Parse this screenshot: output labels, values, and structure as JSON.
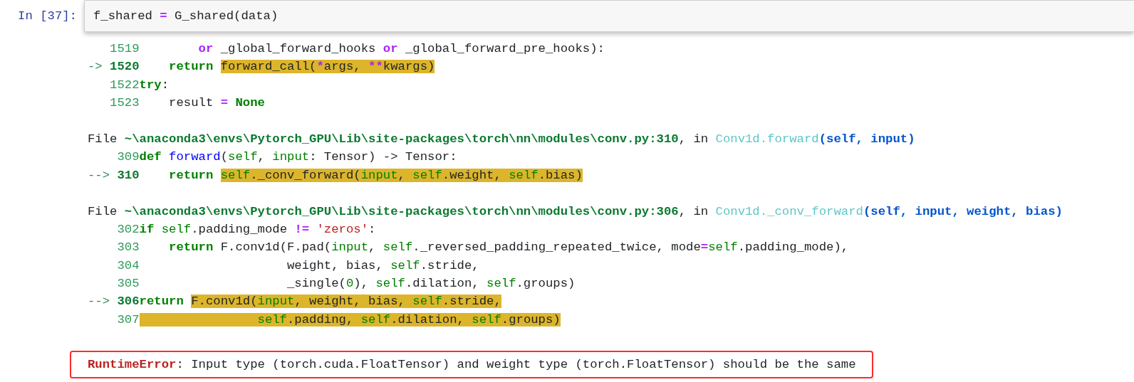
{
  "input_cell": {
    "prompt": "In [37]:",
    "tokens": [
      {
        "text": "f_shared ",
        "kind": "plain"
      },
      {
        "text": "=",
        "kind": "op"
      },
      {
        "text": " G_shared(data)",
        "kind": "plain"
      }
    ]
  },
  "output_lines": [
    {
      "kind": "code",
      "number": "1519",
      "current": false,
      "tokens": [
        {
          "text": "        or",
          "kind": "op"
        },
        {
          "text": " _global_forward_hooks ",
          "kind": "plain"
        },
        {
          "text": "or",
          "kind": "op"
        },
        {
          "text": " _global_forward_pre_hooks):",
          "kind": "plain"
        }
      ]
    },
    {
      "kind": "code",
      "marker": "->",
      "number": "1520",
      "current": true,
      "tokens": [
        {
          "text": "    return ",
          "kind": "kw"
        }
      ],
      "highlight": [
        {
          "text": "forward_call(",
          "kind": "plain"
        },
        {
          "text": "*",
          "kind": "op"
        },
        {
          "text": "args, ",
          "kind": "plain"
        },
        {
          "text": "**",
          "kind": "op"
        },
        {
          "text": "kwargs)",
          "kind": "plain"
        }
      ]
    },
    {
      "kind": "code",
      "number": "1522",
      "current": false,
      "tokens": [
        {
          "text": "try",
          "kind": "kw"
        },
        {
          "text": ":",
          "kind": "plain"
        }
      ]
    },
    {
      "kind": "code",
      "number": "1523",
      "current": false,
      "tokens": [
        {
          "text": "    result ",
          "kind": "plain"
        },
        {
          "text": "=",
          "kind": "op"
        },
        {
          "text": " None",
          "kind": "kw"
        }
      ]
    },
    {
      "kind": "blank"
    },
    {
      "kind": "file",
      "tokens": [
        {
          "text": "File ",
          "kind": "plain"
        },
        {
          "text": "~\\anaconda3\\envs\\Pytorch_GPU\\Lib\\site-packages\\torch\\nn\\modules\\conv.py:310",
          "kind": "path"
        },
        {
          "text": ", in ",
          "kind": "plain"
        },
        {
          "text": "Conv1d.forward",
          "kind": "frame"
        },
        {
          "text": "(self, input)",
          "kind": "args"
        }
      ]
    },
    {
      "kind": "code",
      "number": "309",
      "current": false,
      "tokens": [
        {
          "text": "def ",
          "kind": "kw"
        },
        {
          "text": "forward",
          "kind": "name"
        },
        {
          "text": "(",
          "kind": "plain"
        },
        {
          "text": "self",
          "kind": "self"
        },
        {
          "text": ", ",
          "kind": "plain"
        },
        {
          "text": "input",
          "kind": "self"
        },
        {
          "text": ": Tensor) -> Tensor:",
          "kind": "plain"
        }
      ]
    },
    {
      "kind": "code",
      "marker": "-->",
      "number": "310",
      "current": true,
      "tokens": [
        {
          "text": "    return ",
          "kind": "kw"
        }
      ],
      "highlight": [
        {
          "text": "self",
          "kind": "self"
        },
        {
          "text": "._conv_forward(",
          "kind": "plain"
        },
        {
          "text": "input",
          "kind": "self"
        },
        {
          "text": ", ",
          "kind": "plain"
        },
        {
          "text": "self",
          "kind": "self"
        },
        {
          "text": ".weight, ",
          "kind": "plain"
        },
        {
          "text": "self",
          "kind": "self"
        },
        {
          "text": ".bias)",
          "kind": "plain"
        }
      ]
    },
    {
      "kind": "blank"
    },
    {
      "kind": "file",
      "tokens": [
        {
          "text": "File ",
          "kind": "plain"
        },
        {
          "text": "~\\anaconda3\\envs\\Pytorch_GPU\\Lib\\site-packages\\torch\\nn\\modules\\conv.py:306",
          "kind": "path"
        },
        {
          "text": ", in ",
          "kind": "plain"
        },
        {
          "text": "Conv1d._conv_forward",
          "kind": "frame"
        },
        {
          "text": "(self, input, weight, bias)",
          "kind": "args"
        }
      ]
    },
    {
      "kind": "code",
      "number": "302",
      "current": false,
      "tokens": [
        {
          "text": "if ",
          "kind": "kw"
        },
        {
          "text": "self",
          "kind": "self"
        },
        {
          "text": ".padding_mode ",
          "kind": "plain"
        },
        {
          "text": "!=",
          "kind": "op"
        },
        {
          "text": " 'zeros'",
          "kind": "str"
        },
        {
          "text": ":",
          "kind": "plain"
        }
      ]
    },
    {
      "kind": "code",
      "number": "303",
      "current": false,
      "tokens": [
        {
          "text": "    return",
          "kind": "kw"
        },
        {
          "text": " F.conv1d(F.pad(",
          "kind": "plain"
        },
        {
          "text": "input",
          "kind": "self"
        },
        {
          "text": ", ",
          "kind": "plain"
        },
        {
          "text": "self",
          "kind": "self"
        },
        {
          "text": "._reversed_padding_repeated_twice, mode",
          "kind": "plain"
        },
        {
          "text": "=",
          "kind": "op"
        },
        {
          "text": "self",
          "kind": "self"
        },
        {
          "text": ".padding_mode),",
          "kind": "plain"
        }
      ]
    },
    {
      "kind": "code",
      "number": "304",
      "current": false,
      "tokens": [
        {
          "text": "                    weight, bias, ",
          "kind": "plain"
        },
        {
          "text": "self",
          "kind": "self"
        },
        {
          "text": ".stride,",
          "kind": "plain"
        }
      ]
    },
    {
      "kind": "code",
      "number": "305",
      "current": false,
      "tokens": [
        {
          "text": "                    _single(",
          "kind": "plain"
        },
        {
          "text": "0",
          "kind": "num"
        },
        {
          "text": "), ",
          "kind": "plain"
        },
        {
          "text": "self",
          "kind": "self"
        },
        {
          "text": ".dilation, ",
          "kind": "plain"
        },
        {
          "text": "self",
          "kind": "self"
        },
        {
          "text": ".groups)",
          "kind": "plain"
        }
      ]
    },
    {
      "kind": "code",
      "marker": "-->",
      "number": "306",
      "current": true,
      "tokens": [
        {
          "text": "return ",
          "kind": "kw"
        }
      ],
      "highlight": [
        {
          "text": "F.conv1d(",
          "kind": "plain"
        },
        {
          "text": "input",
          "kind": "self"
        },
        {
          "text": ", weight, bias, ",
          "kind": "plain"
        },
        {
          "text": "self",
          "kind": "self"
        },
        {
          "text": ".stride,",
          "kind": "plain"
        }
      ]
    },
    {
      "kind": "code",
      "number": "307",
      "current": false,
      "highlight": [
        {
          "text": "                self",
          "kind": "self"
        },
        {
          "text": ".padding, ",
          "kind": "plain"
        },
        {
          "text": "self",
          "kind": "self"
        },
        {
          "text": ".dilation, ",
          "kind": "plain"
        },
        {
          "text": "self",
          "kind": "self"
        },
        {
          "text": ".groups)",
          "kind": "plain"
        }
      ]
    },
    {
      "kind": "blank"
    }
  ],
  "error": {
    "name": "RuntimeError",
    "message": ": Input type (torch.cuda.FloatTensor) and weight type (torch.FloatTensor) should be the same"
  }
}
